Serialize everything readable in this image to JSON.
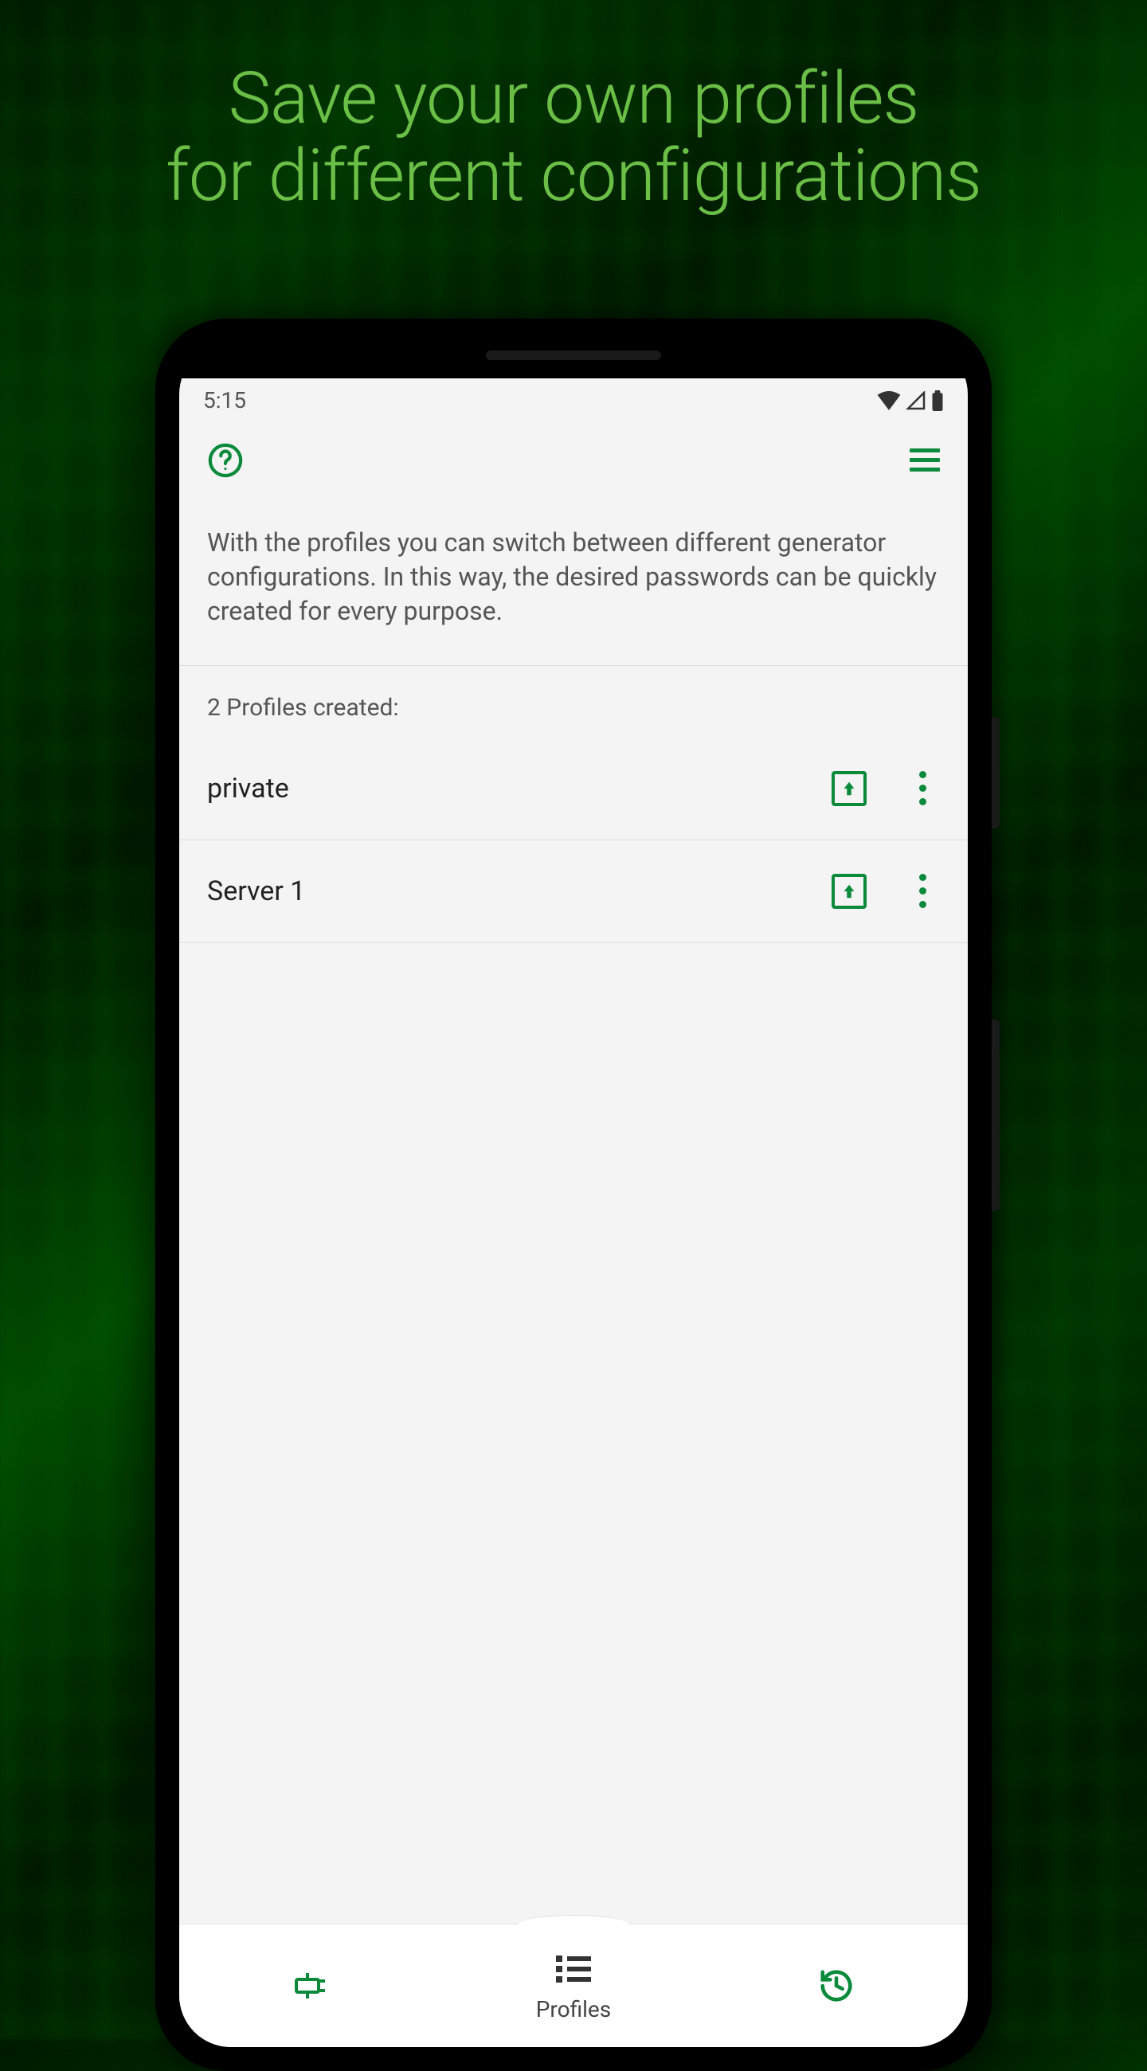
{
  "headline": {
    "line1": "Save your own profiles",
    "line2": "for different configurations"
  },
  "statusBar": {
    "time": "5:15"
  },
  "description": "With the profiles you can switch between different generator configurations. In this way, the desired passwords can be quickly created for every purpose.",
  "profileCount": "2 Profiles created:",
  "profiles": [
    {
      "name": "private"
    },
    {
      "name": "Server 1"
    }
  ],
  "bottomNav": {
    "profiles": "Profiles"
  },
  "colors": {
    "accent": "#0a8a3a",
    "headline": "#6bbf47"
  }
}
